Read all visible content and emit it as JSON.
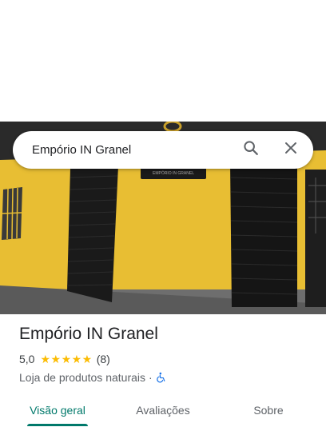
{
  "search": {
    "query": "Empório IN Granel"
  },
  "photo": {
    "sign_text": "EMPÓRIO IN GRANEL"
  },
  "place": {
    "name": "Empório IN Granel",
    "rating": "5,0",
    "stars": "★★★★★",
    "review_count": "(8)",
    "category": "Loja de produtos naturais",
    "separator": "·",
    "accessibility_icon": "wheelchair-icon"
  },
  "tabs": [
    {
      "label": "Visão geral",
      "active": true
    },
    {
      "label": "Avaliações",
      "active": false
    },
    {
      "label": "Sobre",
      "active": false
    }
  ],
  "colors": {
    "accent": "#00796b",
    "star": "#fbbc04",
    "wall": "#e8be33",
    "access": "#1a73e8"
  }
}
